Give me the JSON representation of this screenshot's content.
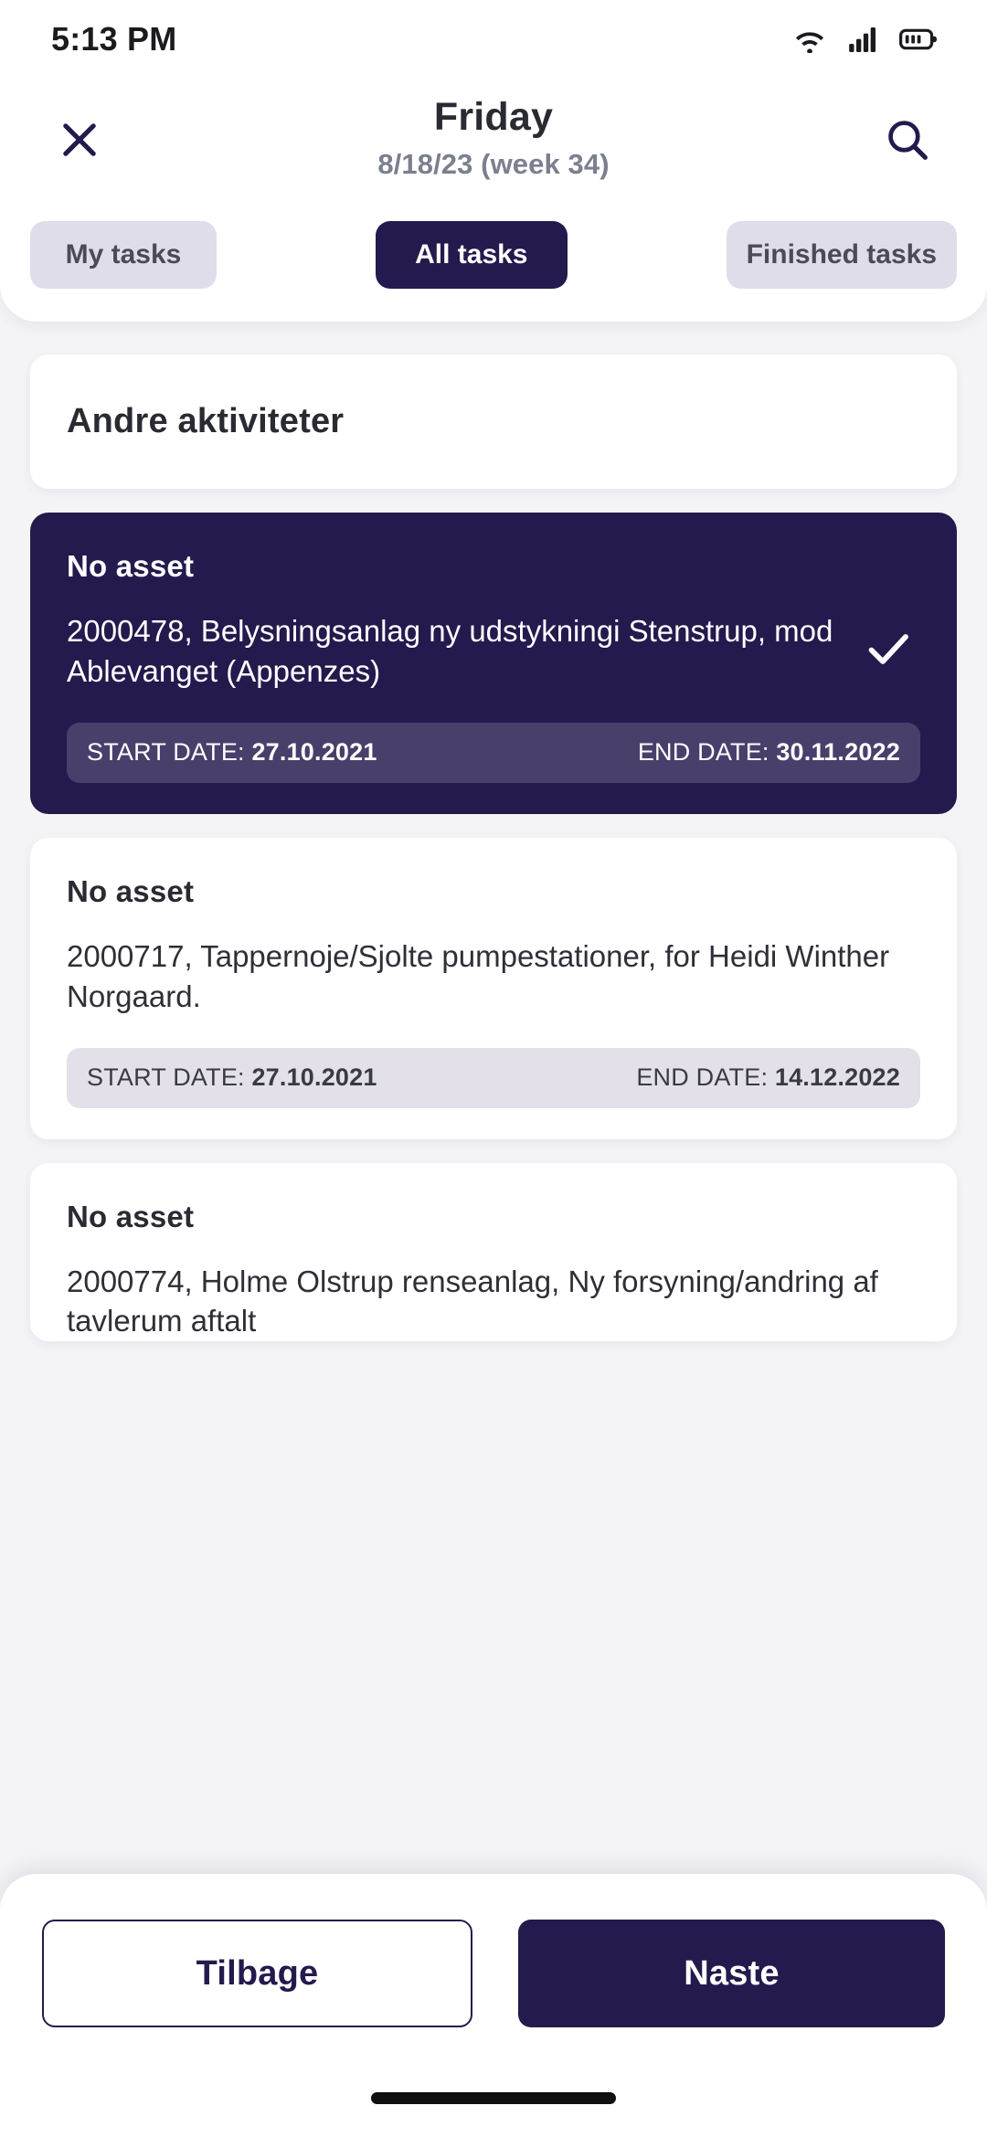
{
  "status_bar": {
    "time": "5:13 PM",
    "icons": [
      "wifi-icon",
      "cellular-signal-icon",
      "battery-icon"
    ]
  },
  "header": {
    "close_icon": "close-icon",
    "search_icon": "search-icon",
    "title": "Friday",
    "subtitle": "8/18/23 (week 34)"
  },
  "tabs": [
    {
      "label": "My tasks",
      "active": false
    },
    {
      "label": "All tasks",
      "active": true
    },
    {
      "label": "Finished tasks",
      "active": false
    }
  ],
  "section": {
    "title": "Andre aktiviteter"
  },
  "tasks": [
    {
      "asset": "No asset",
      "description": "2000478, Belysningsanlag ny udstykningi Stenstrup, mod Ablevanget (Appenzes)",
      "start_label": "START DATE:",
      "start_date": "27.10.2021",
      "end_label": "END DATE:",
      "end_date": "30.11.2022",
      "selected": true,
      "check_icon": "check-icon"
    },
    {
      "asset": "No asset",
      "description": "2000717, Tappernoje/Sjolte pumpestationer, for Heidi Winther Norgaard.",
      "start_label": "START DATE:",
      "start_date": "27.10.2021",
      "end_label": "END DATE:",
      "end_date": "14.12.2022",
      "selected": false
    },
    {
      "asset": "No asset",
      "description": "2000774, Holme Olstrup renseanlag, Ny forsyning/andring af tavlerum aftalt",
      "selected": false,
      "truncated": true
    }
  ],
  "bottom_bar": {
    "back_label": "Tilbage",
    "next_label": "Naste"
  },
  "colors": {
    "brand_dark": "#241a4d",
    "tab_inactive_bg": "#e0ddea",
    "page_bg": "#f4f4f7",
    "date_bar_bg": "#e3e0ea",
    "date_bar_bg_selected": "#4a3f6b",
    "subtitle_gray": "#7b7f8e"
  }
}
